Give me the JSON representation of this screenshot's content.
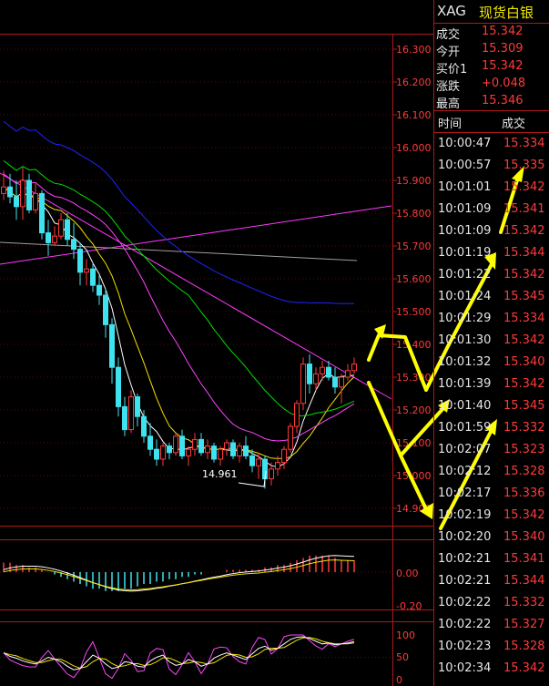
{
  "header": {
    "code": "XAG",
    "name": "现货白银"
  },
  "quote": [
    {
      "label": "成交",
      "value": "15.342"
    },
    {
      "label": "今开",
      "value": "15.309"
    },
    {
      "label": "买价1",
      "value": "15.342"
    },
    {
      "label": "涨跌",
      "value": "+0.048"
    },
    {
      "label": "最高",
      "value": "15.346"
    }
  ],
  "ticks_header": {
    "time": "时间",
    "price": "成交"
  },
  "ticks": [
    {
      "time": "10:00:47",
      "price": "15.334"
    },
    {
      "time": "10:00:57",
      "price": "15.335"
    },
    {
      "time": "10:01:01",
      "price": "15.342"
    },
    {
      "time": "10:01:09",
      "price": "15.341"
    },
    {
      "time": "10:01:09",
      "price": "15.342"
    },
    {
      "time": "10:01:19",
      "price": "15.344"
    },
    {
      "time": "10:01:22",
      "price": "15.342"
    },
    {
      "time": "10:01:24",
      "price": "15.345"
    },
    {
      "time": "10:01:29",
      "price": "15.334"
    },
    {
      "time": "10:01:30",
      "price": "15.342"
    },
    {
      "time": "10:01:32",
      "price": "15.340"
    },
    {
      "time": "10:01:39",
      "price": "15.342"
    },
    {
      "time": "10:01:40",
      "price": "15.345"
    },
    {
      "time": "10:01:59",
      "price": "15.332"
    },
    {
      "time": "10:02:07",
      "price": "15.323"
    },
    {
      "time": "10:02:12",
      "price": "15.328"
    },
    {
      "time": "10:02:17",
      "price": "15.336"
    },
    {
      "time": "10:02:19",
      "price": "15.342"
    },
    {
      "time": "10:02:20",
      "price": "15.340"
    },
    {
      "time": "10:02:21",
      "price": "15.341"
    },
    {
      "time": "10:02:21",
      "price": "15.344"
    },
    {
      "time": "10:02:22",
      "price": "15.332"
    },
    {
      "time": "10:02:22",
      "price": "15.327"
    },
    {
      "time": "10:02:23",
      "price": "15.328"
    },
    {
      "time": "10:02:34",
      "price": "15.342"
    }
  ],
  "price_axis": {
    "ticks": [
      "16.300",
      "16.200",
      "16.100",
      "16.000",
      "15.900",
      "15.800",
      "15.700",
      "15.600",
      "15.500",
      "15.400",
      "15.300",
      "15.200",
      "15.100",
      "15.000",
      "14.900"
    ]
  },
  "annotation": {
    "low_label": "14.961"
  },
  "macd_axis": {
    "ticks": [
      "0.00",
      "-0.20"
    ]
  },
  "kdj_axis": {
    "ticks": [
      "100",
      "50",
      "0"
    ]
  },
  "colors": {
    "up": "#ff3a3a",
    "down": "#3fe3ef",
    "grid": "#b01818",
    "ma5": "#ffffff",
    "ma10": "#f4e200",
    "ma20": "#ff44ff",
    "ma30": "#00e000",
    "ma60": "#2222ff",
    "trend": "#ff3aff",
    "arrow": "#ffff00"
  },
  "chart_data": {
    "type": "candlestick",
    "y_range": [
      14.86,
      16.34
    ],
    "candles": [
      [
        15.86,
        15.93,
        15.84,
        15.88
      ],
      [
        15.88,
        15.92,
        15.83,
        15.85
      ],
      [
        15.85,
        15.9,
        15.78,
        15.82
      ],
      [
        15.82,
        15.94,
        15.78,
        15.9
      ],
      [
        15.9,
        15.92,
        15.8,
        15.81
      ],
      [
        15.81,
        15.89,
        15.8,
        15.86
      ],
      [
        15.86,
        15.87,
        15.72,
        15.74
      ],
      [
        15.74,
        15.78,
        15.67,
        15.71
      ],
      [
        15.71,
        15.76,
        15.7,
        15.73
      ],
      [
        15.73,
        15.8,
        15.72,
        15.78
      ],
      [
        15.78,
        15.8,
        15.7,
        15.72
      ],
      [
        15.72,
        15.77,
        15.66,
        15.69
      ],
      [
        15.69,
        15.71,
        15.58,
        15.62
      ],
      [
        15.62,
        15.66,
        15.58,
        15.63
      ],
      [
        15.63,
        15.65,
        15.56,
        15.58
      ],
      [
        15.58,
        15.61,
        15.52,
        15.55
      ],
      [
        15.55,
        15.57,
        15.42,
        15.46
      ],
      [
        15.46,
        15.48,
        15.28,
        15.33
      ],
      [
        15.33,
        15.36,
        15.18,
        15.21
      ],
      [
        15.21,
        15.24,
        15.12,
        15.14
      ],
      [
        15.14,
        15.26,
        15.13,
        15.24
      ],
      [
        15.24,
        15.25,
        15.15,
        15.18
      ],
      [
        15.18,
        15.2,
        15.1,
        15.12
      ],
      [
        15.12,
        15.16,
        15.06,
        15.08
      ],
      [
        15.08,
        15.11,
        15.03,
        15.05
      ],
      [
        15.05,
        15.1,
        15.03,
        15.09
      ],
      [
        15.09,
        15.1,
        15.05,
        15.07
      ],
      [
        15.07,
        15.13,
        15.06,
        15.12
      ],
      [
        15.12,
        15.14,
        15.05,
        15.06
      ],
      [
        15.06,
        15.09,
        15.03,
        15.08
      ],
      [
        15.08,
        15.13,
        15.06,
        15.11
      ],
      [
        15.11,
        15.13,
        15.06,
        15.07
      ],
      [
        15.07,
        15.11,
        15.05,
        15.09
      ],
      [
        15.09,
        15.1,
        15.04,
        15.05
      ],
      [
        15.05,
        15.09,
        15.03,
        15.08
      ],
      [
        15.08,
        15.11,
        15.06,
        15.1
      ],
      [
        15.1,
        15.11,
        15.05,
        15.06
      ],
      [
        15.06,
        15.1,
        15.04,
        15.09
      ],
      [
        15.09,
        15.12,
        15.05,
        15.06
      ],
      [
        15.06,
        15.08,
        15.01,
        15.03
      ],
      [
        15.03,
        15.07,
        14.99,
        15.05
      ],
      [
        15.05,
        15.06,
        14.96,
        14.99
      ],
      [
        14.99,
        15.04,
        14.97,
        15.02
      ],
      [
        15.02,
        15.06,
        15.0,
        15.04
      ],
      [
        15.04,
        15.09,
        15.02,
        15.08
      ],
      [
        15.08,
        15.16,
        15.07,
        15.15
      ],
      [
        15.15,
        15.23,
        15.13,
        15.22
      ],
      [
        15.22,
        15.36,
        15.2,
        15.34
      ],
      [
        15.34,
        15.37,
        15.25,
        15.28
      ],
      [
        15.28,
        15.33,
        15.26,
        15.31
      ],
      [
        15.31,
        15.35,
        15.29,
        15.33
      ],
      [
        15.33,
        15.35,
        15.29,
        15.3
      ],
      [
        15.3,
        15.33,
        15.25,
        15.27
      ],
      [
        15.27,
        15.31,
        15.22,
        15.3
      ],
      [
        15.3,
        15.34,
        15.29,
        15.32
      ],
      [
        15.32,
        15.36,
        15.31,
        15.34
      ]
    ],
    "macd_histogram": [
      0.04,
      0.04,
      0.03,
      0.03,
      0.02,
      0.02,
      0.01,
      0.0,
      -0.01,
      -0.02,
      -0.03,
      -0.04,
      -0.05,
      -0.06,
      -0.07,
      -0.07,
      -0.08,
      -0.08,
      -0.08,
      -0.07,
      -0.07,
      -0.06,
      -0.05,
      -0.05,
      -0.04,
      -0.04,
      -0.03,
      -0.03,
      -0.02,
      -0.02,
      -0.01,
      -0.01,
      0.0,
      0.0,
      0.0,
      0.01,
      0.01,
      0.01,
      0.01,
      0.01,
      0.01,
      0.02,
      0.02,
      0.03,
      0.03,
      0.04,
      0.05,
      0.06,
      0.07,
      0.07,
      0.07,
      0.07,
      0.06,
      0.05,
      0.05,
      0.05
    ],
    "kdj_k": [
      60,
      52,
      48,
      42,
      38,
      35,
      42,
      50,
      46,
      40,
      30,
      22,
      25,
      40,
      55,
      48,
      35,
      25,
      28,
      40,
      38,
      30,
      28,
      42,
      50,
      55,
      40,
      32,
      35,
      45,
      40,
      30,
      35,
      48,
      55,
      60,
      55,
      50,
      45,
      58,
      70,
      75,
      66,
      70,
      80,
      90,
      95,
      96,
      92,
      86,
      80,
      82,
      78,
      80,
      82,
      85
    ]
  }
}
